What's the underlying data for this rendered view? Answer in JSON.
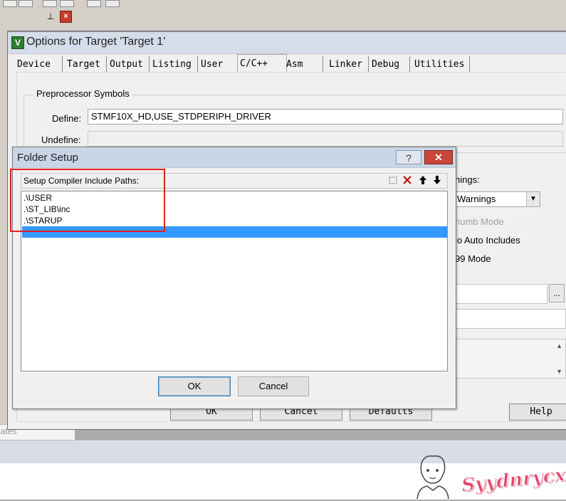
{
  "background": {
    "bottom_tab_text": "lates"
  },
  "options_dialog": {
    "title": "Options for Target 'Target 1'",
    "icon": "keil-uvision-icon",
    "tabs": [
      {
        "label": "Device"
      },
      {
        "label": "Target"
      },
      {
        "label": "Output"
      },
      {
        "label": "Listing"
      },
      {
        "label": "User"
      },
      {
        "label": "C/C++",
        "active": true
      },
      {
        "label": "Asm"
      },
      {
        "label": "Linker"
      },
      {
        "label": "Debug"
      },
      {
        "label": "Utilities"
      }
    ],
    "preprocessor": {
      "group_title": "Preprocessor Symbols",
      "define_label": "Define:",
      "define_value": "STMF10X_HD,USE_STDPERIPH_DRIVER",
      "undefine_label": "Undefine:",
      "undefine_value": ""
    },
    "right_panel": {
      "warnings_label": "nings:",
      "warnings_value": "Warnings",
      "thumb_mode": "humb Mode",
      "no_auto_includes": "lo Auto Includes",
      "c99_mode": "99 Mode",
      "browse_label": "..."
    },
    "buttons": {
      "ok": "OK",
      "cancel": "Cancel",
      "defaults": "Defaults",
      "help": "Help"
    }
  },
  "folder_setup": {
    "title": "Folder Setup",
    "help_label": "?",
    "close_label": "✕",
    "header_label": "Setup Compiler Include Paths:",
    "header_icons": [
      "new-folder-icon",
      "delete-icon",
      "move-up-icon",
      "move-down-icon"
    ],
    "paths": [
      ".\\USER",
      ".\\ST_LIB\\inc",
      ".\\STARUP"
    ],
    "ok_label": "OK",
    "cancel_label": "Cancel"
  },
  "watermark": {
    "text": "Syydnrycx"
  },
  "colors": {
    "selection": "#3399ff",
    "highlight_box": "#e02020",
    "watermark": "#e2476a"
  }
}
